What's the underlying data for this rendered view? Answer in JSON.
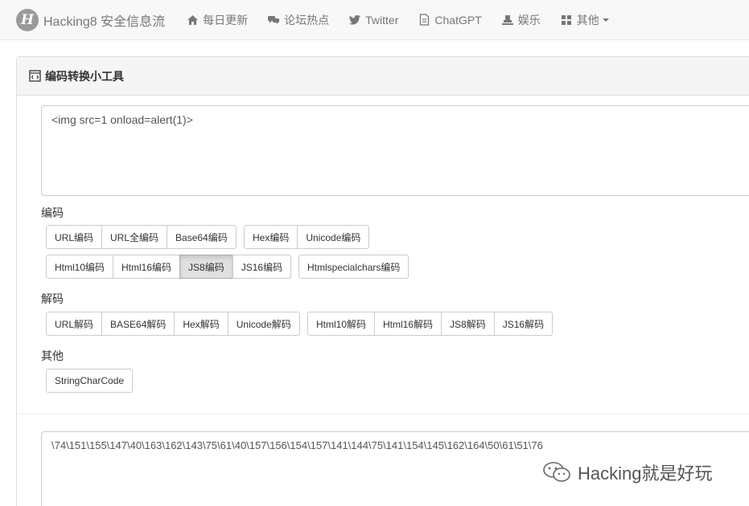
{
  "navbar": {
    "brand_logo_letter": "H",
    "brand_text": "Hacking8 安全信息流",
    "items": [
      {
        "label": "每日更新",
        "icon": "home-icon"
      },
      {
        "label": "论坛热点",
        "icon": "comments-icon"
      },
      {
        "label": "Twitter",
        "icon": "twitter-icon"
      },
      {
        "label": "ChatGPT",
        "icon": "file-icon"
      },
      {
        "label": "娱乐",
        "icon": "user-desk-icon"
      },
      {
        "label": "其他",
        "icon": "grid-icon"
      }
    ]
  },
  "panel": {
    "title": "编码转换小工具",
    "input_value": "<img src=1 onload=alert(1)>",
    "output_value": "\\74\\151\\155\\147\\40\\163\\162\\143\\75\\61\\40\\157\\156\\154\\157\\141\\144\\75\\141\\154\\145\\162\\164\\50\\61\\51\\76"
  },
  "encode": {
    "label": "编码",
    "group1": [
      "URL编码",
      "URL全编码",
      "Base64编码"
    ],
    "group2": [
      "Hex编码",
      "Unicode编码"
    ],
    "group3": [
      "Html10编码",
      "Html16编码",
      "JS8编码",
      "JS16编码"
    ],
    "group4": [
      "Htmlspecialchars编码"
    ],
    "active": "JS8编码"
  },
  "decode": {
    "label": "解码",
    "group1": [
      "URL解码",
      "BASE64解码",
      "Hex解码",
      "Unicode解码"
    ],
    "group2": [
      "Html10解码",
      "Html16解码",
      "JS8解码",
      "JS16解码"
    ]
  },
  "other": {
    "label": "其他",
    "group1": [
      "StringCharCode"
    ]
  },
  "watermark": {
    "text": "Hacking就是好玩"
  }
}
